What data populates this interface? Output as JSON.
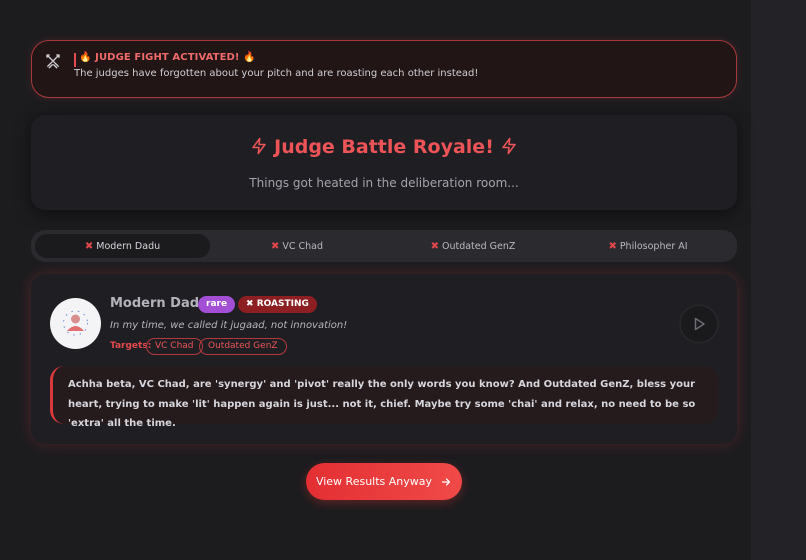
{
  "alert": {
    "title": "🔥 JUDGE FIGHT ACTIVATED! 🔥",
    "description": "The judges have forgotten about your pitch and are roasting each other instead!",
    "icon": "crossed-swords-icon"
  },
  "header": {
    "title": "Judge Battle Royale!",
    "subtitle": "Things got heated in the deliberation room...",
    "icon": "lightning-bolt-icon"
  },
  "tabs": [
    {
      "label": "Modern Dadu",
      "active": true
    },
    {
      "label": "VC Chad",
      "active": false
    },
    {
      "label": "Outdated GenZ",
      "active": false
    },
    {
      "label": "Philosopher AI",
      "active": false
    }
  ],
  "judge": {
    "name": "Modern Dadu",
    "rarity": "rare",
    "status": "ROASTING",
    "quote": "In my time, we called it jugaad, not innovation!",
    "targets_label": "Targets:",
    "targets": [
      "VC Chad",
      "Outdated GenZ"
    ],
    "roast": "Achha beta, VC Chad, are 'synergy' and 'pivot' really the only words you know? And Outdated GenZ, bless your heart, trying to make 'lit' happen again is just... not it, chief. Maybe try some 'chai' and relax, no need to be so 'extra' all the time."
  },
  "cta": {
    "label": "View Results Anyway"
  },
  "colors": {
    "accent": "#ec5458",
    "background": "#1c1c1f",
    "card": "#1f1f23",
    "rare_badge": "#a24fd6",
    "roasting_badge": "#8d1f23"
  }
}
